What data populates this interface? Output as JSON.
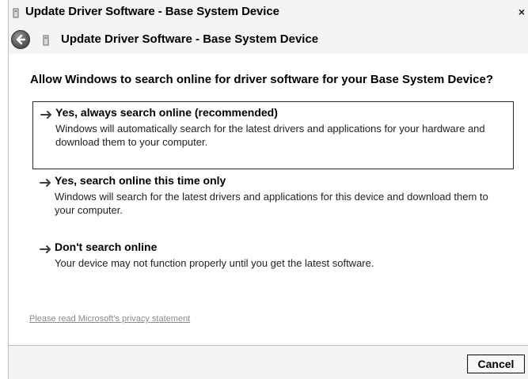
{
  "window": {
    "title": "Update Driver Software - Base System Device",
    "close_label": "×"
  },
  "header": {
    "title": "Update Driver Software - Base System Device"
  },
  "content": {
    "question": "Allow Windows to search online for driver software for your Base System Device?",
    "options": [
      {
        "title": "Yes, always search online (recommended)",
        "description": "Windows will automatically search for the latest drivers and applications for your hardware and download them to your computer.",
        "selected": true
      },
      {
        "title": "Yes, search online this time only",
        "description": "Windows will search for the latest drivers and applications for this device and download them to your computer.",
        "selected": false
      },
      {
        "title": "Don't search online",
        "description": "Your device may not function properly until you get the latest software.",
        "selected": false
      }
    ],
    "privacy_link": "Please read Microsoft's privacy statement"
  },
  "footer": {
    "cancel_label": "Cancel"
  },
  "icons": {
    "title_icon": "device-icon",
    "back_icon": "back-arrow-icon",
    "option_icon": "green-arrow-icon"
  }
}
